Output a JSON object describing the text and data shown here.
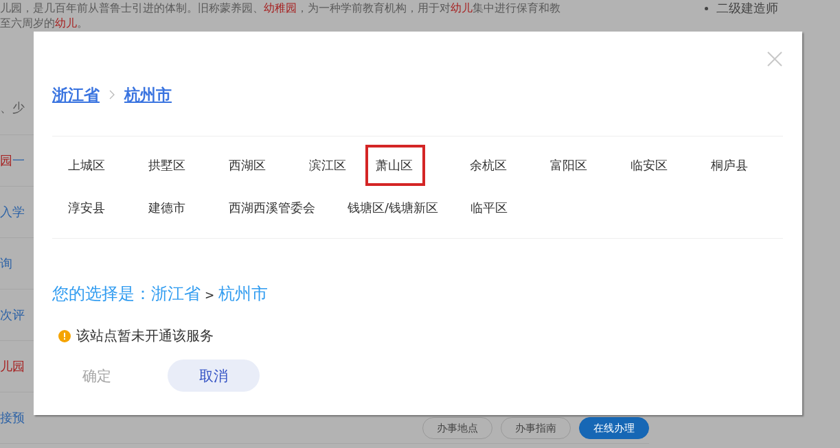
{
  "background_page": {
    "intro_lines": [
      [
        {
          "text": "儿园，是几百年前从普鲁士引进的体制。旧称蒙养园、",
          "color": "#5a5a5a"
        },
        {
          "text": "幼稚园",
          "color": "#a62020"
        },
        {
          "text": "，为一种学前教育机构，用于对",
          "color": "#5a5a5a"
        },
        {
          "text": "幼儿",
          "color": "#a62020"
        },
        {
          "text": "集中进行保育和教",
          "color": "#5a5a5a"
        }
      ],
      [
        {
          "text": "至六周岁的",
          "color": "#5a5a5a"
        },
        {
          "text": "幼儿",
          "color": "#a62020"
        },
        {
          "text": "。"
        }
      ]
    ],
    "sidebar_link": "二级建造师",
    "list_items": [
      {
        "segments": [
          {
            "text": "、少",
            "color": "#5a5a5a"
          }
        ]
      },
      {
        "segments": [
          {
            "text": "园",
            "color": "#a62020"
          },
          {
            "text": "一"
          }
        ]
      },
      {
        "segments": [
          {
            "text": "入学",
            "color": "#2e63a6"
          }
        ]
      },
      {
        "segments": [
          {
            "text": "询",
            "color": "#2e63a6"
          }
        ]
      },
      {
        "segments": [
          {
            "text": "次评",
            "color": "#2e63a6"
          }
        ]
      },
      {
        "segments": [
          {
            "text": "儿园",
            "color": "#a62020"
          }
        ]
      },
      {
        "segments": [
          {
            "text": "接预",
            "color": "#2e63a6"
          }
        ],
        "actions": [
          {
            "label": "办事地点",
            "kind": "outline"
          },
          {
            "label": "办事指南",
            "kind": "outline"
          },
          {
            "label": "在线办理",
            "kind": "primary"
          }
        ]
      }
    ]
  },
  "dialog": {
    "breadcrumb": [
      "浙江省",
      "杭州市"
    ],
    "districts": [
      {
        "name": "上城区",
        "highlighted": false
      },
      {
        "name": "拱墅区",
        "highlighted": false
      },
      {
        "name": "西湖区",
        "highlighted": false
      },
      {
        "name": "滨江区",
        "highlighted": false
      },
      {
        "name": "萧山区",
        "highlighted": true
      },
      {
        "name": "余杭区",
        "highlighted": false
      },
      {
        "name": "富阳区",
        "highlighted": false
      },
      {
        "name": "临安区",
        "highlighted": false
      },
      {
        "name": "桐庐县",
        "highlighted": false
      },
      {
        "name": "淳安县",
        "highlighted": false
      },
      {
        "name": "建德市",
        "highlighted": false
      },
      {
        "name": "西湖西溪管委会",
        "highlighted": false
      },
      {
        "name": "钱塘区/钱塘新区",
        "highlighted": false
      },
      {
        "name": "临平区",
        "highlighted": false
      }
    ],
    "selection": {
      "label": "您的选择是：",
      "path": [
        "浙江省",
        "杭州市"
      ],
      "separator": ">"
    },
    "notice": "该站点暂未开通该服务",
    "buttons": [
      {
        "label": "确定",
        "kind": "confirm",
        "disabled": true
      },
      {
        "label": "取消",
        "kind": "cancel",
        "disabled": false
      }
    ]
  }
}
